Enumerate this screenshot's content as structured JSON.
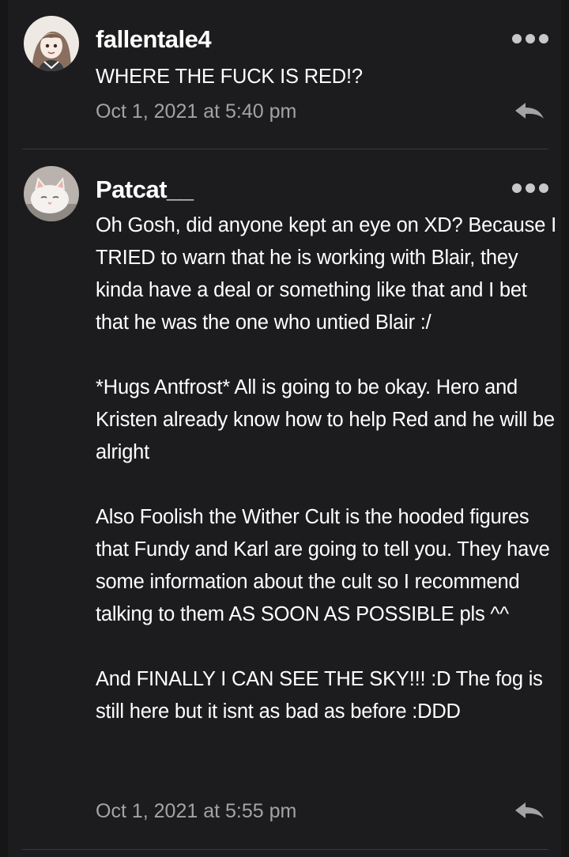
{
  "comments": [
    {
      "username": "fallentale4",
      "text": "WHERE THE FUCK IS RED!?",
      "timestamp": "Oct 1, 2021 at 5:40 pm",
      "avatar_icon": "anime-girl-avatar"
    },
    {
      "username": "Patcat__",
      "text": "Oh Gosh, did anyone kept an eye on XD? Because I TRIED to warn that he is working with Blair, they kinda have a deal or something like that and I bet that he was the one who untied Blair :/\n\n*Hugs Antfrost* All is going to be okay. Hero and Kristen already know how to help Red and he will be alright\n\nAlso Foolish the Wither Cult is the hooded figures that Fundy and Karl are going to tell you. They have some information about the cult so I recommend talking to them AS SOON AS POSSIBLE pls ^^\n\nAnd FINALLY I CAN SEE THE SKY!!! :D The fog is still here but it isnt as bad as before :DDD",
      "timestamp": "Oct 1, 2021 at 5:55 pm",
      "avatar_icon": "white-cat-avatar"
    }
  ],
  "colors": {
    "background": "#1c1c1e",
    "text": "#ffffff",
    "muted": "#a3a3a3",
    "divider": "#3a3a3c"
  }
}
